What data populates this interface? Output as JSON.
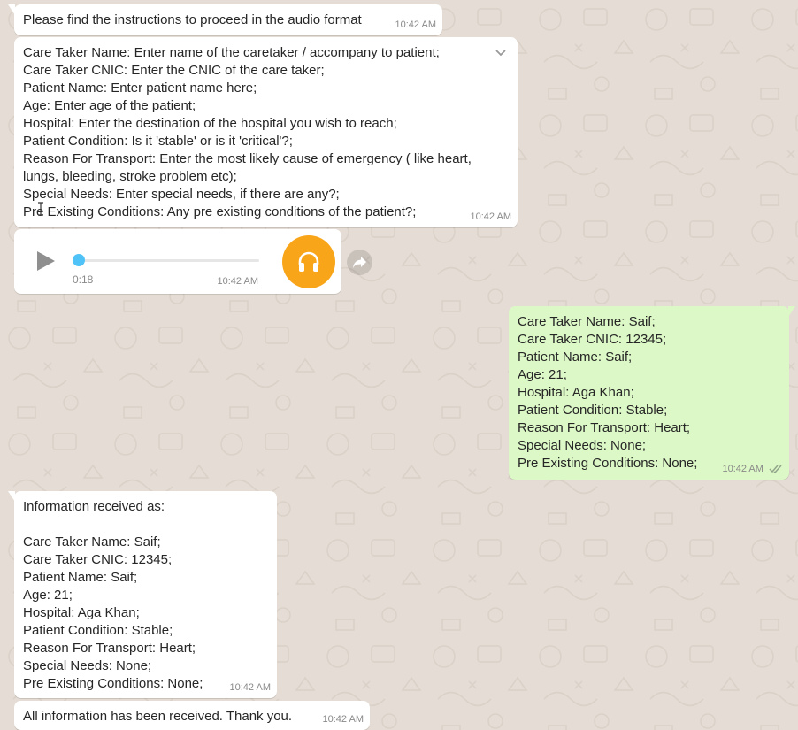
{
  "colors": {
    "chat_background": "#e5ddd5",
    "incoming_bubble": "#ffffff",
    "outgoing_bubble": "#dcf8c6",
    "timestamp": "#8a8a8a",
    "audio_progress": "#4fc3f7",
    "audio_avatar": "#f9a51a"
  },
  "messages": [
    {
      "direction": "incoming",
      "text": "Please find the instructions to proceed in the audio format",
      "time": "10:42 AM"
    },
    {
      "direction": "incoming",
      "text": "Care Taker Name: Enter name of the caretaker / accompany to patient;\nCare Taker CNIC: Enter the CNIC of the care taker;\nPatient Name: Enter patient name here;\nAge: Enter age of the patient;\nHospital: Enter the destination of the hospital you wish to reach;\nPatient Condition: Is it 'stable' or is it 'critical'?;\nReason For Transport: Enter the most likely cause of emergency ( like heart,\nlungs, bleeding, stroke problem etc);\nSpecial Needs: Enter special needs, if there are any?;\nPre Existing Conditions: Any pre existing conditions of the patient?;",
      "time": "10:42 AM",
      "menu_icon": "chevron-down-icon"
    },
    {
      "direction": "incoming",
      "type": "audio",
      "duration": "0:18",
      "time": "10:42 AM",
      "progress": 0,
      "icons": [
        "play-icon",
        "headphones-icon",
        "forward-icon"
      ]
    },
    {
      "direction": "outgoing",
      "text": "Care Taker Name: Saif;\nCare Taker CNIC: 12345;\nPatient Name: Saif;\nAge: 21;\nHospital: Aga Khan;\nPatient Condition: Stable;\nReason For Transport: Heart;\nSpecial Needs: None;\nPre Existing Conditions: None;",
      "time": "10:42 AM",
      "status_icon": "double-check-icon"
    },
    {
      "direction": "incoming",
      "text": "Information received as:\n\nCare Taker Name: Saif;\nCare Taker CNIC: 12345;\nPatient Name: Saif;\nAge: 21;\nHospital: Aga Khan;\nPatient Condition: Stable;\nReason For Transport: Heart;\nSpecial Needs: None;\nPre Existing Conditions: None;",
      "time": "10:42 AM"
    },
    {
      "direction": "incoming",
      "text": "All information has been received. Thank you.",
      "time": "10:42 AM"
    }
  ]
}
